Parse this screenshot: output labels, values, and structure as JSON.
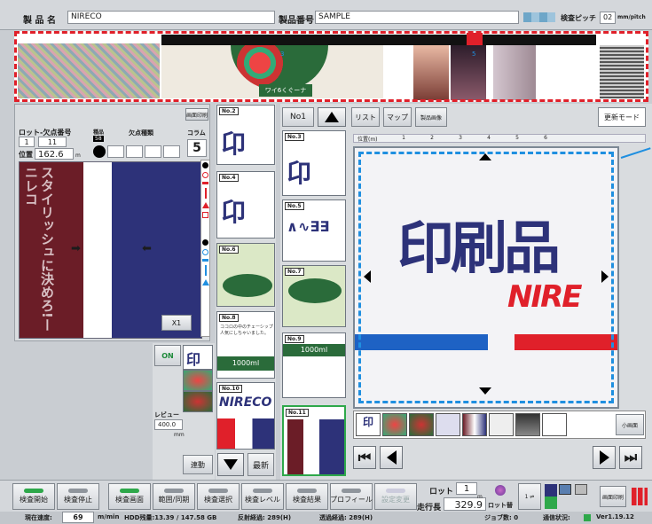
{
  "header": {
    "product_name_label": "製 品 名",
    "product_name_value": "NIRECO",
    "product_no_label": "製品番号",
    "product_no_value": "SAMPLE",
    "pitch_label": "検査ピッチ",
    "pitch_value": "02",
    "pitch_unit": "mm/pitch"
  },
  "strip": {
    "labels": [
      "ワイ6くぐーナ",
      "3",
      "5"
    ]
  },
  "left": {
    "header_btn": "画面印刷",
    "lot_defect_label": "ロット-欠点番号",
    "lot_value": "1",
    "defect_no_value": "11",
    "pos_label": "位置",
    "pos_value": "162.6",
    "pos_unit": "m",
    "kind_label": "種品",
    "kind_value": "58",
    "defect_type_label": "欠点種類",
    "column_label": "コラム",
    "column_value": "5",
    "vertical_text": "スタイリッシュに決めろ!ーニレコ",
    "zoom_btn": "X1"
  },
  "middle": {
    "col1_tags": [
      "No.2",
      "No.4",
      "No.6",
      "No.8",
      "No.10"
    ],
    "col2_tags": [
      "No.3",
      "No.5",
      "No.7",
      "No.9",
      "No.11"
    ],
    "no1_btn": "No1",
    "latest_btn": "最新",
    "liquid_1": "1000ml",
    "liquid_2": "1000ml",
    "brand": "NIRECO",
    "jp_print": "印",
    "milk_text": "ココロの中のチェーシップ 人気にしちゃいました。"
  },
  "review": {
    "on_btn": "ON",
    "speed_label": "レビュー",
    "speed_value": "400.0",
    "speed_unit": "mm",
    "link_btn": "連動"
  },
  "right": {
    "tab_list": "リスト",
    "tab_map": "マップ",
    "tab_image": "製品画像",
    "mode_btn": "更新モード",
    "ruler_label": "位置(m)",
    "ruler_ticks": [
      "1",
      "2",
      "3",
      "4",
      "5",
      "6"
    ],
    "main_text": "印刷品",
    "main_brand": "NIRE",
    "small_btn": "小画面"
  },
  "toolbar": {
    "buttons": [
      "検査開始",
      "検査停止",
      "検査画面",
      "範囲/同期",
      "検査選択",
      "検査レベル",
      "検査結果",
      "プロフィール",
      "設定変更"
    ],
    "lot_label": "ロット",
    "lot_value": "1",
    "travel_label": "走行長",
    "travel_value": "329.9",
    "travel_unit": "m",
    "lot_switch": "ロット替",
    "print_btn": "画面印刷",
    "version": "Ver1.19.12"
  },
  "status": {
    "speed_label": "現在速度:",
    "speed_value": "69",
    "speed_unit": "m/min",
    "hdd": "HDD残量:13.39 / 147.58 GB",
    "reflect": "反射経過: 289(H)",
    "transmit": "透過経過: 289(H)",
    "jobs": "ジョブ数: 0",
    "comm": "通信状況:"
  },
  "colors": {
    "accent_red": "#e0202a",
    "accent_blue": "#1f8fe0",
    "navy": "#2d3279",
    "maroon": "#6b1d27",
    "green": "#2ea84a"
  }
}
